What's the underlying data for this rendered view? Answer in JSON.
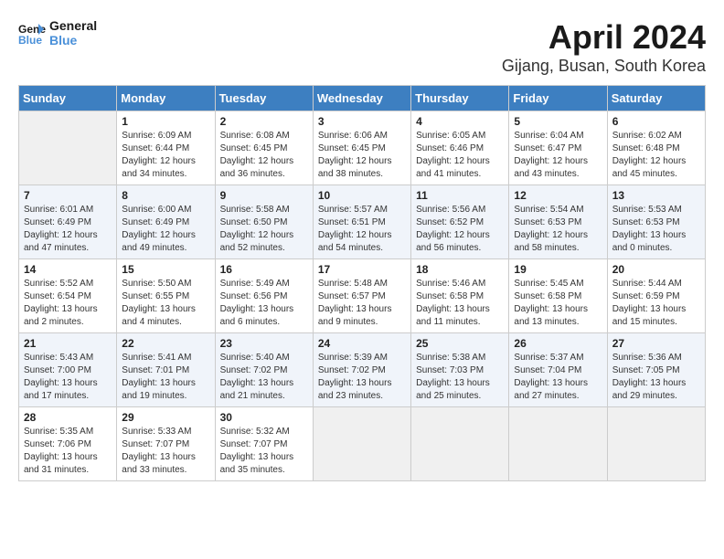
{
  "header": {
    "logo_line1": "General",
    "logo_line2": "Blue",
    "month": "April 2024",
    "location": "Gijang, Busan, South Korea"
  },
  "days_of_week": [
    "Sunday",
    "Monday",
    "Tuesday",
    "Wednesday",
    "Thursday",
    "Friday",
    "Saturday"
  ],
  "weeks": [
    [
      {
        "day": "",
        "info": ""
      },
      {
        "day": "1",
        "info": "Sunrise: 6:09 AM\nSunset: 6:44 PM\nDaylight: 12 hours\nand 34 minutes."
      },
      {
        "day": "2",
        "info": "Sunrise: 6:08 AM\nSunset: 6:45 PM\nDaylight: 12 hours\nand 36 minutes."
      },
      {
        "day": "3",
        "info": "Sunrise: 6:06 AM\nSunset: 6:45 PM\nDaylight: 12 hours\nand 38 minutes."
      },
      {
        "day": "4",
        "info": "Sunrise: 6:05 AM\nSunset: 6:46 PM\nDaylight: 12 hours\nand 41 minutes."
      },
      {
        "day": "5",
        "info": "Sunrise: 6:04 AM\nSunset: 6:47 PM\nDaylight: 12 hours\nand 43 minutes."
      },
      {
        "day": "6",
        "info": "Sunrise: 6:02 AM\nSunset: 6:48 PM\nDaylight: 12 hours\nand 45 minutes."
      }
    ],
    [
      {
        "day": "7",
        "info": "Sunrise: 6:01 AM\nSunset: 6:49 PM\nDaylight: 12 hours\nand 47 minutes."
      },
      {
        "day": "8",
        "info": "Sunrise: 6:00 AM\nSunset: 6:49 PM\nDaylight: 12 hours\nand 49 minutes."
      },
      {
        "day": "9",
        "info": "Sunrise: 5:58 AM\nSunset: 6:50 PM\nDaylight: 12 hours\nand 52 minutes."
      },
      {
        "day": "10",
        "info": "Sunrise: 5:57 AM\nSunset: 6:51 PM\nDaylight: 12 hours\nand 54 minutes."
      },
      {
        "day": "11",
        "info": "Sunrise: 5:56 AM\nSunset: 6:52 PM\nDaylight: 12 hours\nand 56 minutes."
      },
      {
        "day": "12",
        "info": "Sunrise: 5:54 AM\nSunset: 6:53 PM\nDaylight: 12 hours\nand 58 minutes."
      },
      {
        "day": "13",
        "info": "Sunrise: 5:53 AM\nSunset: 6:53 PM\nDaylight: 13 hours\nand 0 minutes."
      }
    ],
    [
      {
        "day": "14",
        "info": "Sunrise: 5:52 AM\nSunset: 6:54 PM\nDaylight: 13 hours\nand 2 minutes."
      },
      {
        "day": "15",
        "info": "Sunrise: 5:50 AM\nSunset: 6:55 PM\nDaylight: 13 hours\nand 4 minutes."
      },
      {
        "day": "16",
        "info": "Sunrise: 5:49 AM\nSunset: 6:56 PM\nDaylight: 13 hours\nand 6 minutes."
      },
      {
        "day": "17",
        "info": "Sunrise: 5:48 AM\nSunset: 6:57 PM\nDaylight: 13 hours\nand 9 minutes."
      },
      {
        "day": "18",
        "info": "Sunrise: 5:46 AM\nSunset: 6:58 PM\nDaylight: 13 hours\nand 11 minutes."
      },
      {
        "day": "19",
        "info": "Sunrise: 5:45 AM\nSunset: 6:58 PM\nDaylight: 13 hours\nand 13 minutes."
      },
      {
        "day": "20",
        "info": "Sunrise: 5:44 AM\nSunset: 6:59 PM\nDaylight: 13 hours\nand 15 minutes."
      }
    ],
    [
      {
        "day": "21",
        "info": "Sunrise: 5:43 AM\nSunset: 7:00 PM\nDaylight: 13 hours\nand 17 minutes."
      },
      {
        "day": "22",
        "info": "Sunrise: 5:41 AM\nSunset: 7:01 PM\nDaylight: 13 hours\nand 19 minutes."
      },
      {
        "day": "23",
        "info": "Sunrise: 5:40 AM\nSunset: 7:02 PM\nDaylight: 13 hours\nand 21 minutes."
      },
      {
        "day": "24",
        "info": "Sunrise: 5:39 AM\nSunset: 7:02 PM\nDaylight: 13 hours\nand 23 minutes."
      },
      {
        "day": "25",
        "info": "Sunrise: 5:38 AM\nSunset: 7:03 PM\nDaylight: 13 hours\nand 25 minutes."
      },
      {
        "day": "26",
        "info": "Sunrise: 5:37 AM\nSunset: 7:04 PM\nDaylight: 13 hours\nand 27 minutes."
      },
      {
        "day": "27",
        "info": "Sunrise: 5:36 AM\nSunset: 7:05 PM\nDaylight: 13 hours\nand 29 minutes."
      }
    ],
    [
      {
        "day": "28",
        "info": "Sunrise: 5:35 AM\nSunset: 7:06 PM\nDaylight: 13 hours\nand 31 minutes."
      },
      {
        "day": "29",
        "info": "Sunrise: 5:33 AM\nSunset: 7:07 PM\nDaylight: 13 hours\nand 33 minutes."
      },
      {
        "day": "30",
        "info": "Sunrise: 5:32 AM\nSunset: 7:07 PM\nDaylight: 13 hours\nand 35 minutes."
      },
      {
        "day": "",
        "info": ""
      },
      {
        "day": "",
        "info": ""
      },
      {
        "day": "",
        "info": ""
      },
      {
        "day": "",
        "info": ""
      }
    ]
  ]
}
